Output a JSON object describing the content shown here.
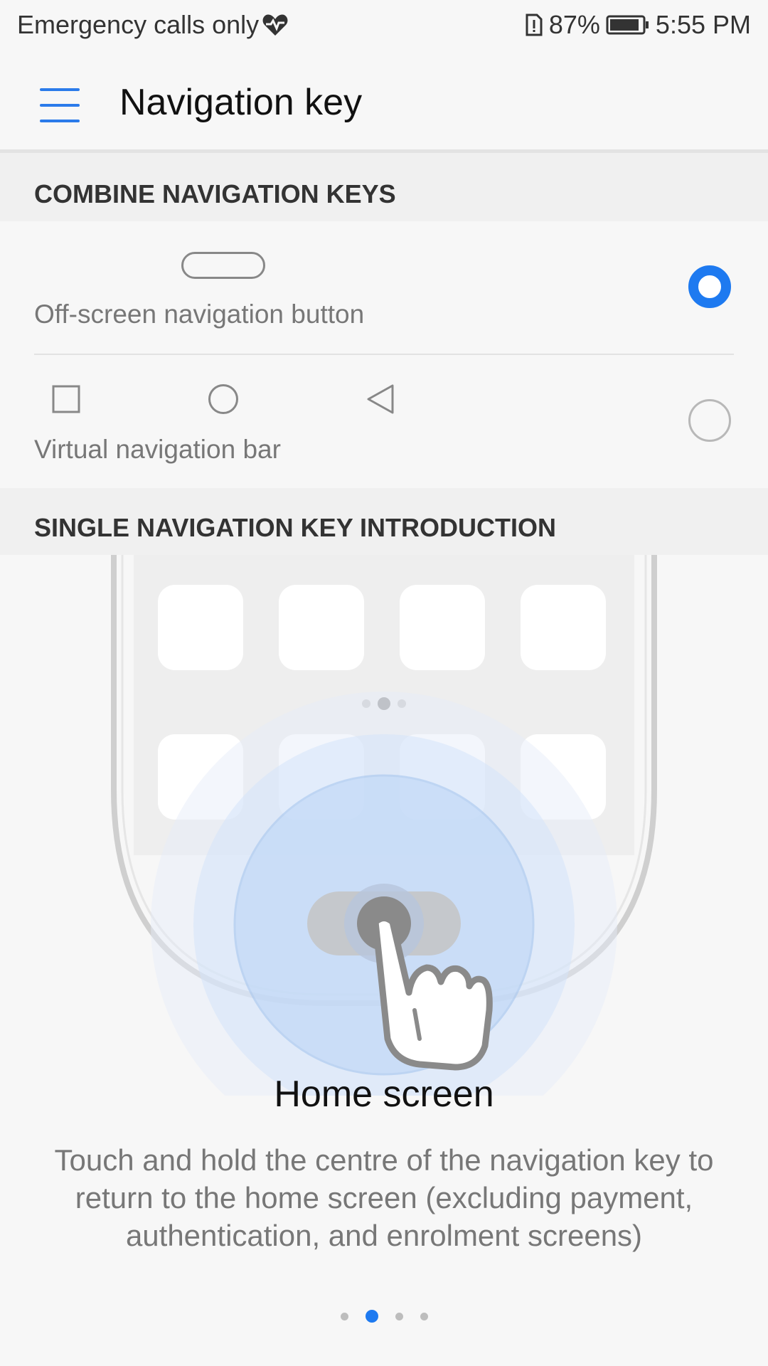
{
  "status_bar": {
    "carrier_text": "Emergency calls only",
    "battery_percent": "87%",
    "time": "5:55 PM"
  },
  "app_bar": {
    "title": "Navigation key"
  },
  "sections": {
    "combine_header": "COMBINE NAVIGATION KEYS",
    "intro_header": "SINGLE NAVIGATION KEY INTRODUCTION"
  },
  "options": [
    {
      "label": "Off-screen navigation button",
      "selected": true
    },
    {
      "label": "Virtual navigation bar",
      "selected": false
    }
  ],
  "intro": {
    "title": "Home screen",
    "description": "Touch and hold the centre of the navigation key to return to the home screen (excluding payment, authentication, and enrolment screens)"
  },
  "pager": {
    "page_count": 4,
    "active_index": 1
  },
  "colors": {
    "accent": "#1e7af0",
    "menu_icon": "#2b7bea",
    "background": "#f7f7f7",
    "section_bg": "#f0f0f0"
  }
}
